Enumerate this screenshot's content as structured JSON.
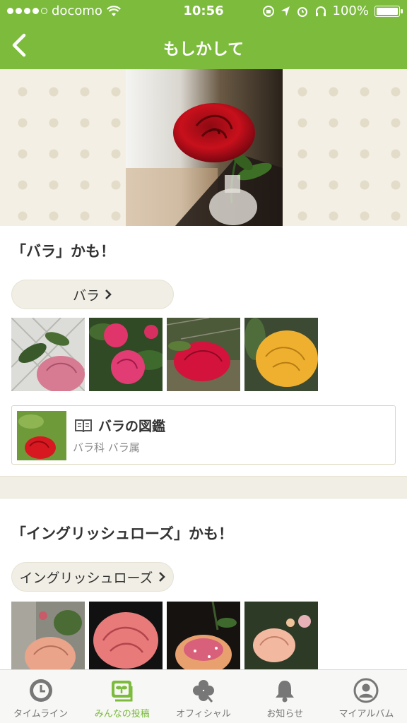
{
  "status_bar": {
    "carrier": "docomo",
    "time": "10:56",
    "battery": "100%",
    "battery_level": 1.0
  },
  "nav": {
    "title": "もしかして"
  },
  "results": [
    {
      "heading": "「バラ」かも！",
      "pill_label": "バラ",
      "encyclopedia": {
        "title": "バラの図鑑",
        "subtitle": "バラ科 バラ属"
      }
    },
    {
      "heading": "「イングリッシュローズ」かも！",
      "pill_label": "イングリッシュローズ"
    }
  ],
  "tabs": [
    {
      "label": "タイムライン",
      "icon": "clock-icon"
    },
    {
      "label": "みんなの投稿",
      "icon": "sprout-icon",
      "active": true
    },
    {
      "label": "オフィシャル",
      "icon": "clover-icon"
    },
    {
      "label": "お知らせ",
      "icon": "bell-icon"
    },
    {
      "label": "マイアルバム",
      "icon": "person-icon"
    }
  ],
  "colors": {
    "accent": "#7cbb3c",
    "tab_inactive": "#777777",
    "pill_bg": "#f1efe5"
  }
}
